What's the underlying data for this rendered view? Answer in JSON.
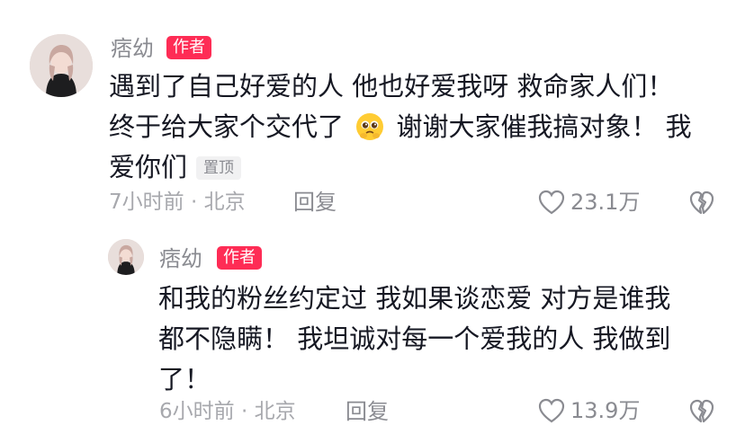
{
  "comments": [
    {
      "username": "痞幼",
      "badge": "作者",
      "lines": [
        "遇到了自己好爱的人 他也好爱我呀 救命家人们！",
        "终于给大家个交代了",
        "谢谢大家催我搞对象！ 我",
        "爱你们"
      ],
      "pin_label": "置顶",
      "time_location": "7小时前 · 北京",
      "reply_label": "回复",
      "like_count": "23.1万"
    },
    {
      "username": "痞幼",
      "badge": "作者",
      "lines": [
        "和我的粉丝约定过 我如果谈恋爱 对方是谁我",
        "都不隐瞒！ 我坦诚对每一个爱我的人 我做到",
        "了！"
      ],
      "time_location": "6小时前 · 北京",
      "reply_label": "回复",
      "like_count": "13.9万"
    }
  ],
  "icons": {
    "emoji": "pleading-face-emoji",
    "like": "heart-outline-icon",
    "dislike": "broken-heart-icon"
  },
  "colors": {
    "badge": "#fe2c55",
    "text": "#161823",
    "muted": "#8a8b91"
  }
}
